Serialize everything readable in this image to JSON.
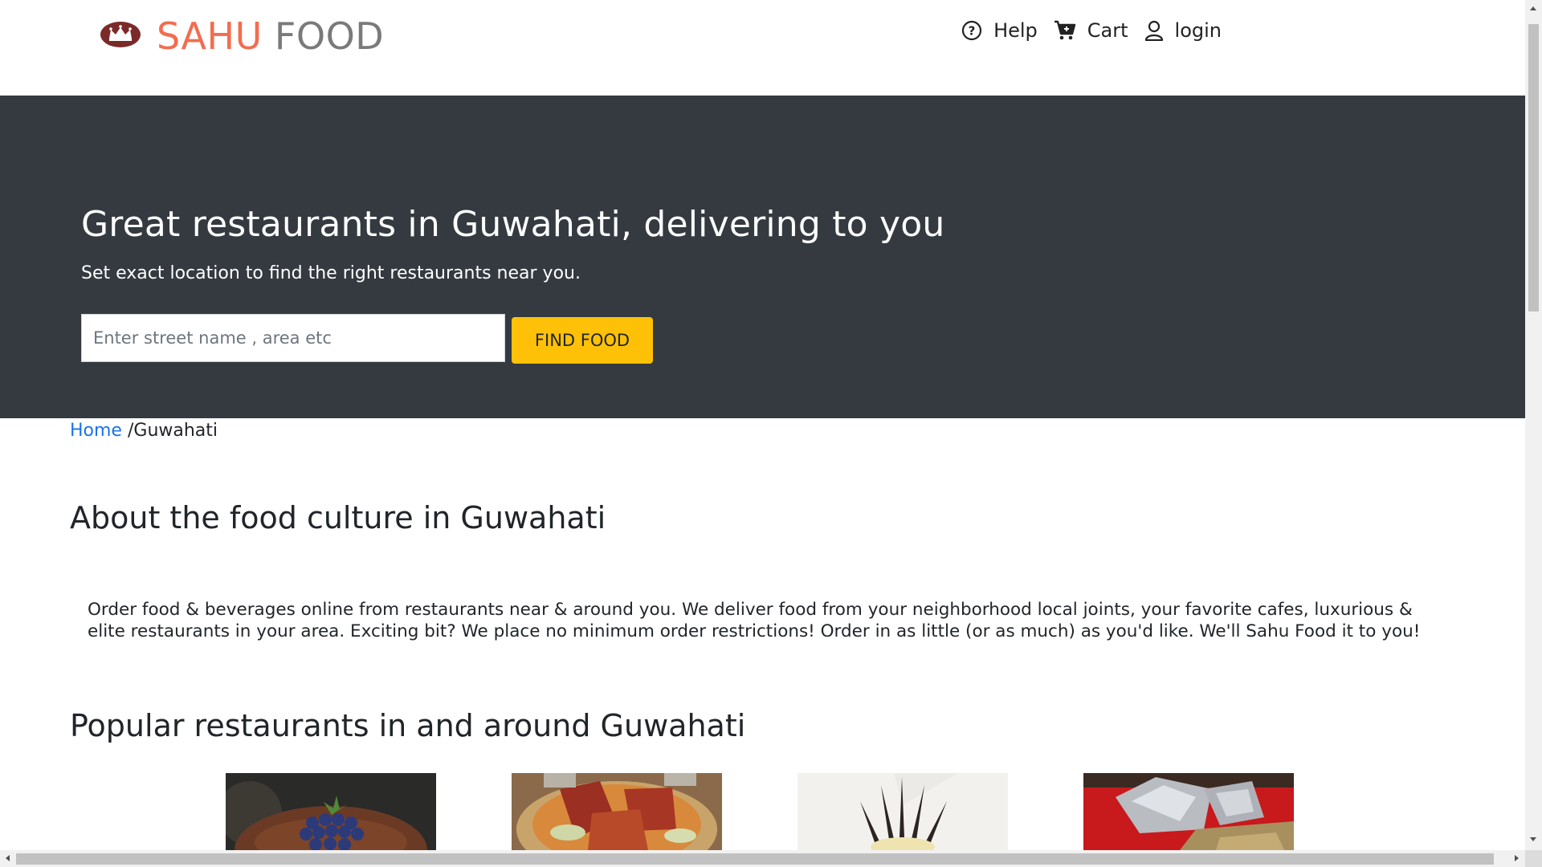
{
  "header": {
    "brand_part1": "SAHU",
    "brand_part2": "FOOD",
    "logo_icon": "crown-logo-icon",
    "nav": [
      {
        "label": "Help",
        "icon": "help-circle-icon"
      },
      {
        "label": "Cart",
        "icon": "cart-icon"
      },
      {
        "label": "login",
        "icon": "user-icon"
      }
    ]
  },
  "hero": {
    "title": "Great restaurants in Guwahati, delivering to you",
    "subtitle": "Set exact location to find the right restaurants near you.",
    "search_placeholder": "Enter street name , area etc",
    "search_value": "",
    "find_button": "FIND FOOD"
  },
  "breadcrumb": {
    "home": "Home",
    "separator": "/",
    "current": "Guwahati"
  },
  "about": {
    "heading": "About the food culture in Guwahati",
    "text": "Order food & beverages online from restaurants near & around you. We deliver food from your neighborhood local joints, your favorite cafes, luxurious & elite restaurants in your area. Exciting bit? We place no minimum order restrictions! Order in as little (or as much) as you'd like. We'll Sahu Food it to you!"
  },
  "popular": {
    "heading": "Popular restaurants in and around Guwahati",
    "cards": [
      {
        "image": "blueberry-cake-image"
      },
      {
        "image": "tandoori-chicken-image"
      },
      {
        "image": "chocolate-dessert-image"
      },
      {
        "image": "foil-wrapped-food-image"
      }
    ]
  },
  "colors": {
    "brand_primary": "#f26d4f",
    "brand_secondary": "#7a7a7a",
    "hero_bg": "#343a40",
    "button_accent": "#ffc107",
    "link": "#1a73e8"
  }
}
